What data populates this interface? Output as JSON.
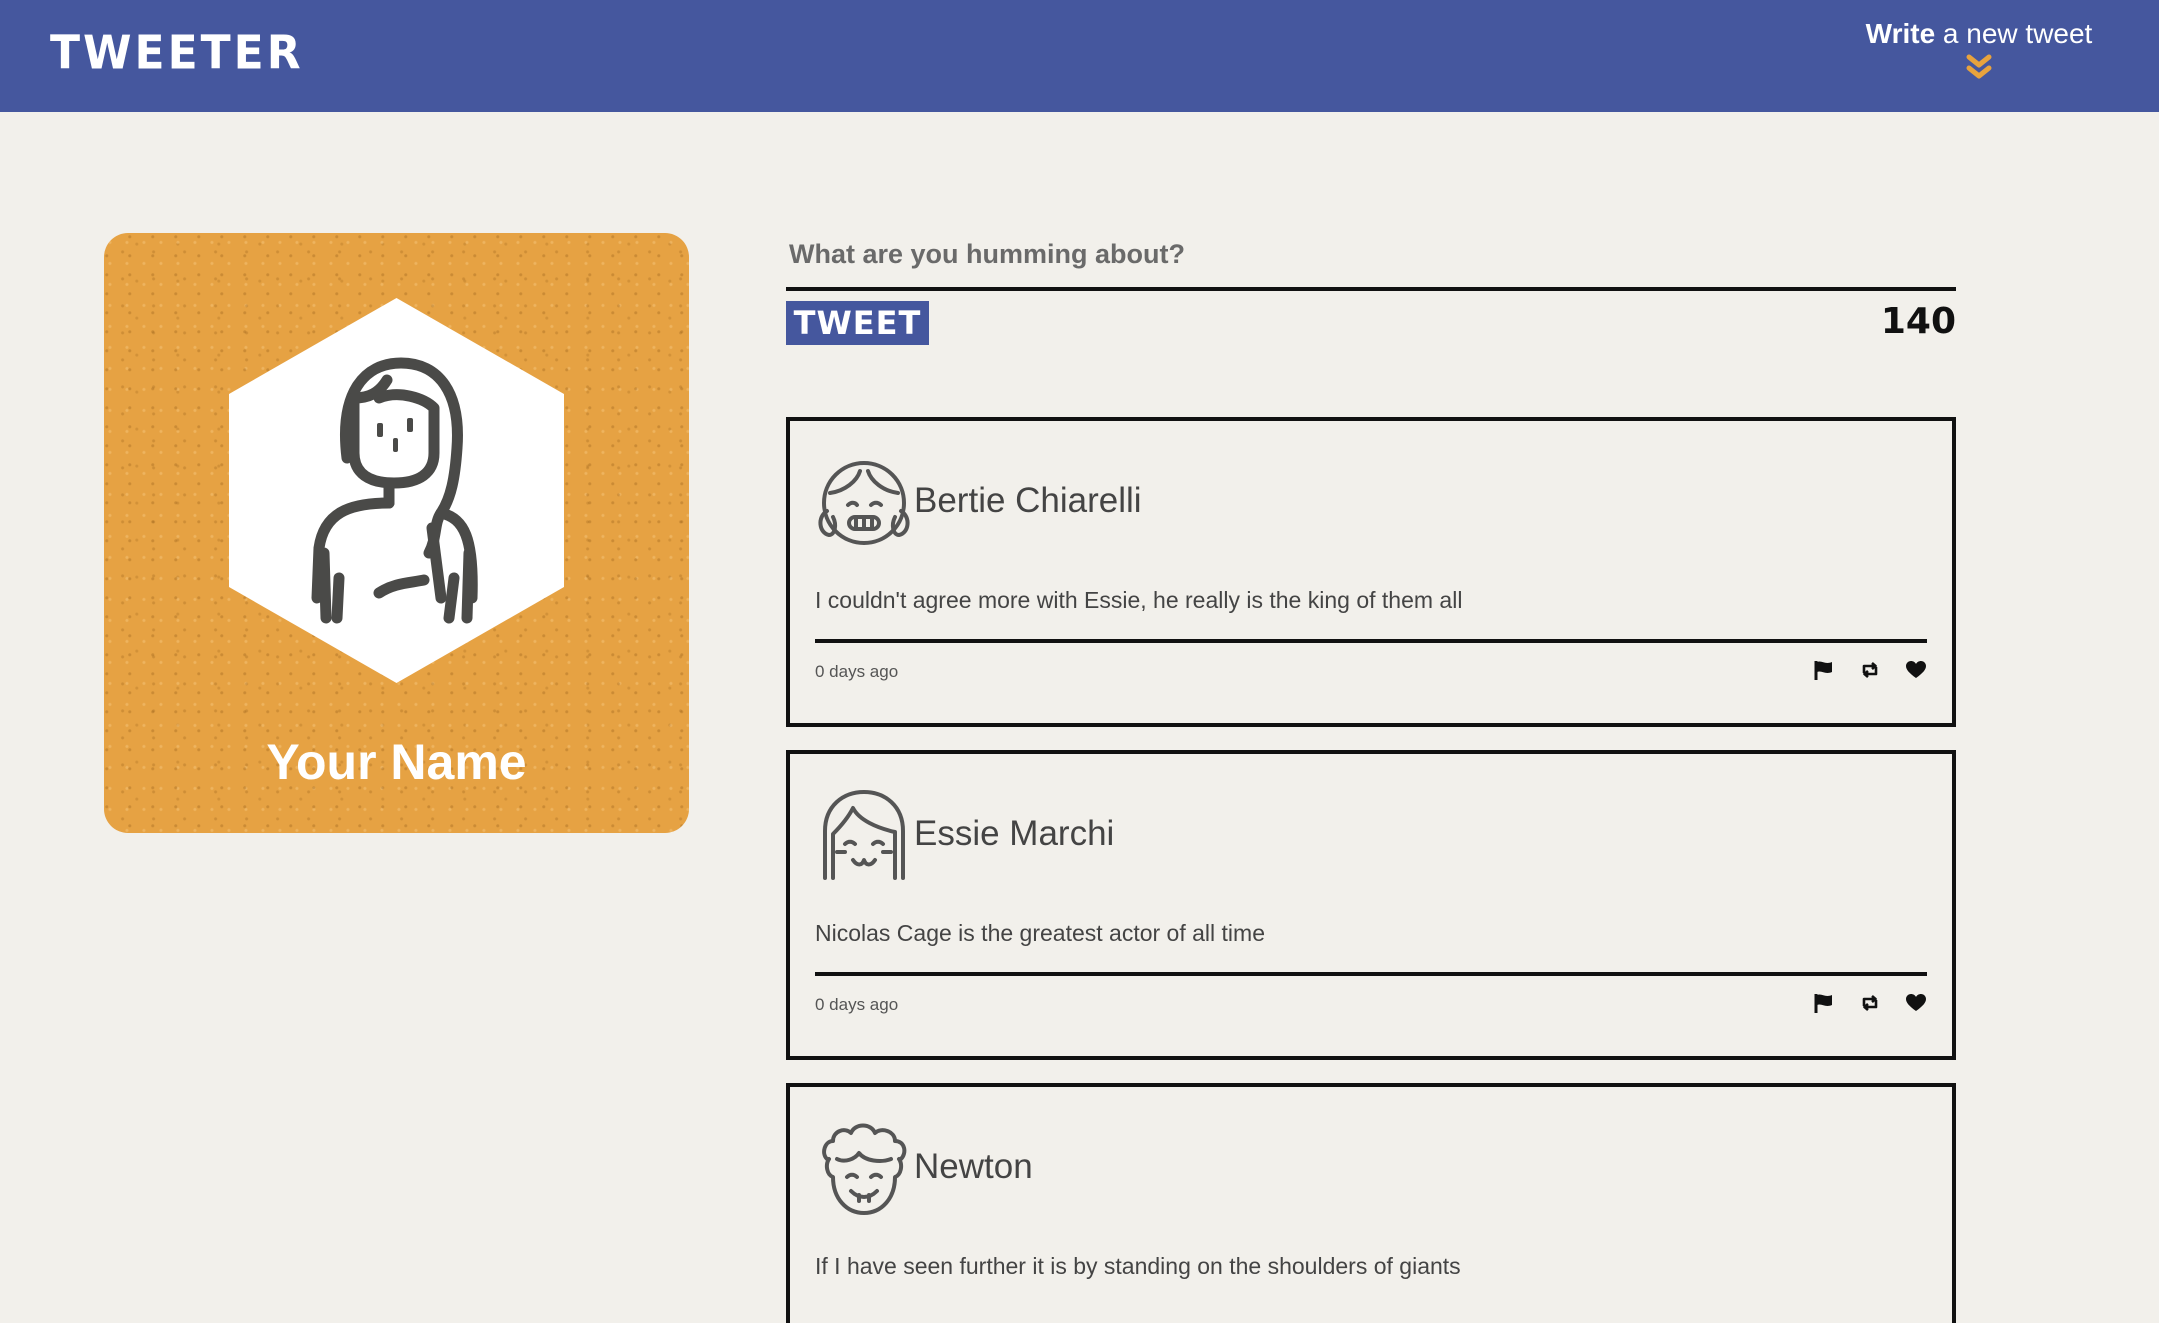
{
  "nav": {
    "brand": "TWEETER",
    "write_bold": "Write",
    "write_rest": " a new tweet",
    "chevron_icon": "double-chevron-down-icon",
    "accent": "#e8a33d",
    "bg": "#45579e"
  },
  "profile": {
    "name": "Your Name",
    "card_color": "#e6a243",
    "avatar_icon": "girl-avatar-icon"
  },
  "compose": {
    "placeholder": "What are you humming about?",
    "value": "",
    "button_label": "TWEET",
    "counter": "140"
  },
  "tweets": [
    {
      "author": "Bertie Chiarelli",
      "content": "I couldn't agree more with Essie, he really is the king of them all",
      "time": "0 days ago",
      "avatar_icon": "girl-pigtails-avatar-icon"
    },
    {
      "author": "Essie Marchi",
      "content": "Nicolas Cage is the greatest actor of all time",
      "time": "0 days ago",
      "avatar_icon": "girl-bangs-avatar-icon"
    },
    {
      "author": "Newton",
      "content": "If I have seen further it is by standing on the shoulders of giants",
      "time": "",
      "avatar_icon": "curly-hair-avatar-icon"
    }
  ],
  "actions": [
    "flag-icon",
    "retweet-icon",
    "heart-icon"
  ]
}
